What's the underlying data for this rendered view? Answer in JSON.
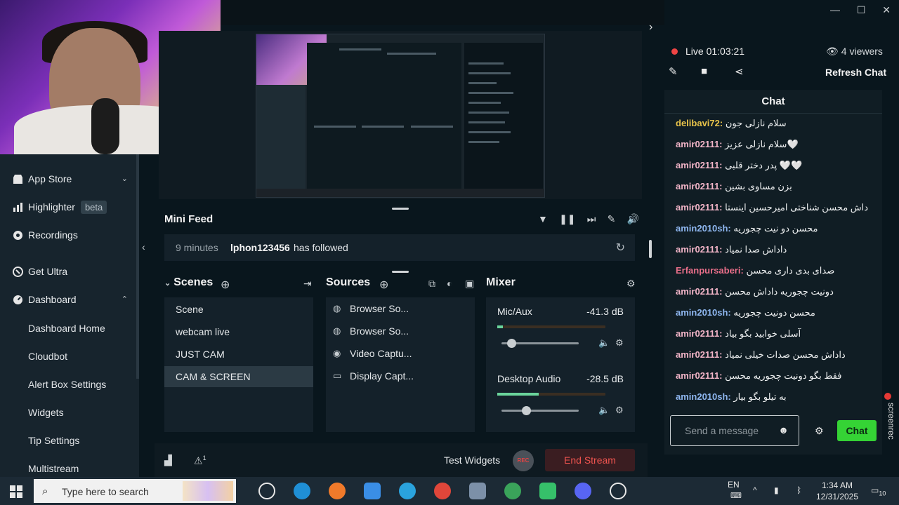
{
  "window": {
    "minimize": "—",
    "maximize": "☐",
    "close": "✕"
  },
  "sidebar": {
    "items": [
      {
        "label": "App Store",
        "icon": "store-icon"
      },
      {
        "label": "Highlighter",
        "badge": "beta",
        "icon": "highlighter-icon"
      },
      {
        "label": "Recordings",
        "icon": "recordings-icon"
      },
      {
        "label": "Get Ultra",
        "icon": "ultra-icon"
      },
      {
        "label": "Dashboard",
        "icon": "dashboard-icon"
      }
    ],
    "sub_items": [
      "Dashboard Home",
      "Cloudbot",
      "Alert Box Settings",
      "Widgets",
      "Tip Settings",
      "Multistream"
    ]
  },
  "mini_feed": {
    "title": "Mini Feed",
    "event": {
      "time": "9 minutes",
      "user": "lphon123456",
      "action": "has followed"
    }
  },
  "scenes": {
    "title": "Scenes",
    "items": [
      "Scene",
      "webcam live",
      "JUST CAM",
      "CAM & SCREEN"
    ],
    "selected": "CAM & SCREEN"
  },
  "sources": {
    "title": "Sources",
    "items": [
      {
        "label": "Browser So...",
        "icon": "globe-icon"
      },
      {
        "label": "Browser So...",
        "icon": "globe-icon"
      },
      {
        "label": "Video Captu...",
        "icon": "webcam-icon"
      },
      {
        "label": "Display Capt...",
        "icon": "monitor-icon"
      }
    ]
  },
  "mixer": {
    "title": "Mixer",
    "channels": [
      {
        "name": "Mic/Aux",
        "db": "-41.3 dB",
        "level": 0.05,
        "volume": 0.13
      },
      {
        "name": "Desktop Audio",
        "db": "-28.5 dB",
        "level": 0.38,
        "volume": 0.32
      }
    ]
  },
  "bottom": {
    "test_widgets": "Test Widgets",
    "rec": "REC",
    "end_stream": "End Stream",
    "alert_count": "1"
  },
  "chat": {
    "live_label": "Live",
    "live_time": "01:03:21",
    "viewers": "4 viewers",
    "refresh": "Refresh Chat",
    "title": "Chat",
    "messages": [
      {
        "user": "delibavi72:",
        "text": "سلام نازلی جون",
        "color": "#e8c34a"
      },
      {
        "user": "amir02111:",
        "text": "سلام نازلی عزیز🤍",
        "color": "#f2b5c8"
      },
      {
        "user": "amir02111:",
        "text": "پدر دختر قلبی 🤍🤍",
        "color": "#f2b5c8"
      },
      {
        "user": "amir02111:",
        "text": "بزن مساوی بشین",
        "color": "#f2b5c8"
      },
      {
        "user": "amir02111:",
        "text": "داش محسن شناختی امیرحسین اینستا",
        "color": "#f2b5c8"
      },
      {
        "user": "amin2010sh:",
        "text": "محسن دو نیت چجوریه",
        "color": "#8fb7f0"
      },
      {
        "user": "amir02111:",
        "text": "داداش صدا نمیاد",
        "color": "#f2b5c8"
      },
      {
        "user": "Erfanpursaberi:",
        "text": "صدای بدی داری محسن",
        "color": "#ea6f8a"
      },
      {
        "user": "amir02111:",
        "text": "دونیت چجوریه داداش محسن",
        "color": "#f2b5c8"
      },
      {
        "user": "amin2010sh:",
        "text": "محسن دونیت چجوریه",
        "color": "#8fb7f0"
      },
      {
        "user": "amir02111:",
        "text": "آسلی خوابید بگو بیاد",
        "color": "#f2b5c8"
      },
      {
        "user": "amir02111:",
        "text": "داداش محسن صدات خیلی نمیاد",
        "color": "#f2b5c8"
      },
      {
        "user": "amir02111:",
        "text": "فقط بگو دونیت چجوریه محسن",
        "color": "#f2b5c8"
      },
      {
        "user": "amin2010sh:",
        "text": "به تیلو بگو بیار",
        "color": "#8fb7f0"
      }
    ],
    "input_placeholder": "Send a message",
    "send": "Chat"
  },
  "screenrec": "screenrec",
  "taskbar": {
    "search_placeholder": "Type here to search",
    "language": "EN",
    "time": "1:34 AM",
    "date": "12/31/2025",
    "notifications": "10"
  }
}
